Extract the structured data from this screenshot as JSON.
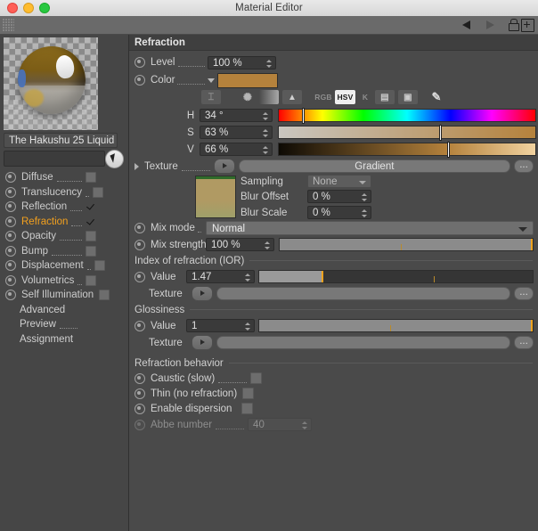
{
  "window": {
    "title": "Material Editor"
  },
  "toolbar": {
    "back_icon": "back-arrow-icon",
    "forward_icon": "forward-arrow-icon",
    "lock_icon": "lock-icon",
    "add_icon": "plus-box-icon"
  },
  "left_panel": {
    "material_name": "The Hakushu 25 Liquid",
    "search_value": "",
    "channels": [
      {
        "label": "Diffuse",
        "checked": false,
        "active": false
      },
      {
        "label": "Translucency",
        "checked": false,
        "active": false
      },
      {
        "label": "Reflection",
        "checked": true,
        "active": false
      },
      {
        "label": "Refraction",
        "checked": true,
        "active": true
      },
      {
        "label": "Opacity",
        "checked": false,
        "active": false
      },
      {
        "label": "Bump",
        "checked": false,
        "active": false
      },
      {
        "label": "Displacement",
        "checked": false,
        "active": false
      },
      {
        "label": "Volumetrics",
        "checked": false,
        "active": false
      },
      {
        "label": "Self Illumination",
        "checked": false,
        "active": false
      }
    ],
    "plain_items": [
      {
        "label": "Advanced",
        "dots": false
      },
      {
        "label": "Preview",
        "dots": true
      },
      {
        "label": "Assignment",
        "dots": false
      }
    ]
  },
  "right_panel": {
    "section_title": "Refraction",
    "level": {
      "label": "Level",
      "value": "100 %"
    },
    "color": {
      "label": "Color",
      "swatch_hex": "#b5823c",
      "mode_buttons": [
        {
          "name": "hsv-picker-icon",
          "glyph": "⌶",
          "selected": false,
          "type": "icon"
        },
        {
          "name": "color-wheel-icon",
          "glyph": "✺",
          "selected": false,
          "type": "icon"
        },
        {
          "name": "gradient-icon",
          "glyph": "▭",
          "selected": false,
          "type": "icon"
        },
        {
          "name": "image-picker-icon",
          "glyph": "▲",
          "selected": false,
          "type": "icon"
        },
        {
          "name": "rgb-mode-button",
          "glyph": "RGB",
          "selected": false,
          "type": "text"
        },
        {
          "name": "hsv-mode-button",
          "glyph": "HSV",
          "selected": true,
          "type": "text"
        },
        {
          "name": "kelvin-mode-button",
          "glyph": "K",
          "selected": false,
          "type": "text"
        },
        {
          "name": "mixer-button",
          "glyph": "▤",
          "selected": false,
          "type": "icon"
        },
        {
          "name": "swatches-button",
          "glyph": "▣",
          "selected": false,
          "type": "icon"
        },
        {
          "name": "eyedropper-icon",
          "glyph": "✎",
          "selected": false,
          "type": "icon"
        }
      ],
      "hsv": [
        {
          "label": "H",
          "value": "34 °",
          "knob_pct": 9.4
        },
        {
          "label": "S",
          "value": "63 %",
          "knob_pct": 63
        },
        {
          "label": "V",
          "value": "66 %",
          "knob_pct": 66
        }
      ]
    },
    "texture": {
      "label": "Texture",
      "shader_name": "Gradient",
      "more_label": "...",
      "sampling_label": "Sampling",
      "sampling_value": "None",
      "blur_offset_label": "Blur Offset",
      "blur_offset_value": "0 %",
      "blur_scale_label": "Blur Scale",
      "blur_scale_value": "0 %"
    },
    "mix_mode": {
      "label": "Mix mode",
      "value": "Normal"
    },
    "mix_strength": {
      "label": "Mix strength",
      "value": "100 %",
      "fill_pct": 100
    },
    "ior_group": {
      "title": "Index of refraction (IOR)",
      "value_label": "Value",
      "value": "1.47",
      "fill_pct": 23,
      "texture_label": "Texture",
      "texture_value": "",
      "more_label": "..."
    },
    "glossiness_group": {
      "title": "Glossiness",
      "value_label": "Value",
      "value": "1",
      "fill_pct": 100,
      "texture_label": "Texture",
      "texture_value": "",
      "more_label": "..."
    },
    "behavior_group": {
      "title": "Refraction behavior",
      "options": [
        {
          "label": "Caustic (slow)",
          "checked": false,
          "disabled": false,
          "dots": true
        },
        {
          "label": "Thin (no refraction)",
          "checked": false,
          "disabled": false,
          "dots": false
        },
        {
          "label": "Enable dispersion",
          "checked": false,
          "disabled": false,
          "dots": false
        }
      ],
      "abbe": {
        "label": "Abbe number",
        "value": "40",
        "disabled": true
      }
    }
  }
}
